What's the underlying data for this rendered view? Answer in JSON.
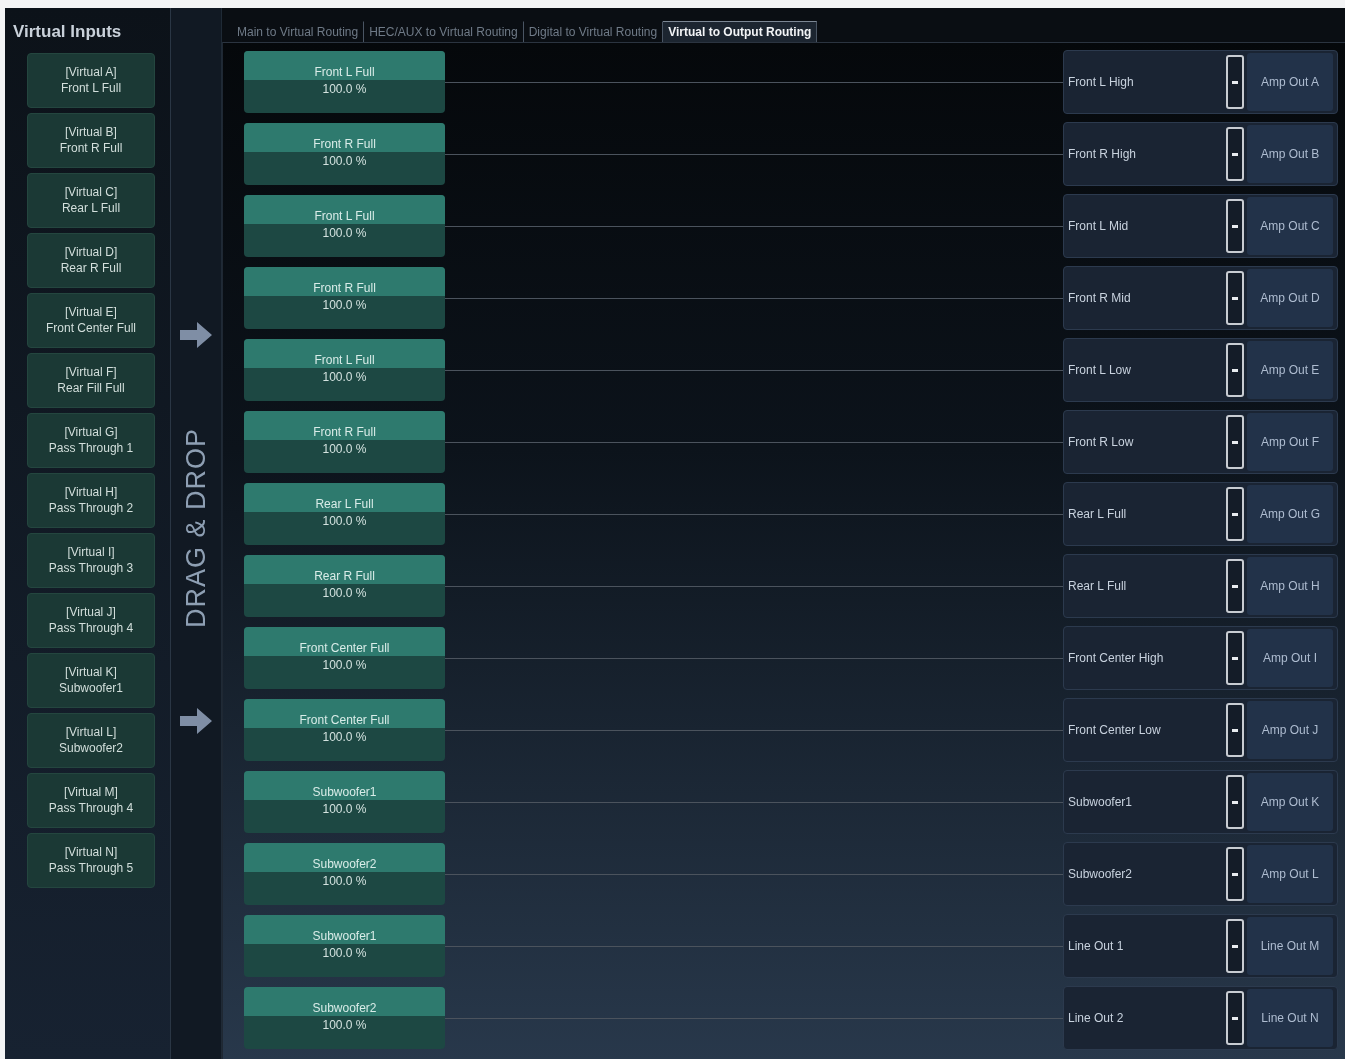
{
  "sidebar": {
    "title": "Virtual Inputs",
    "items": [
      {
        "name": "[Virtual A]",
        "source": "Front L Full"
      },
      {
        "name": "[Virtual B]",
        "source": "Front R Full"
      },
      {
        "name": "[Virtual C]",
        "source": "Rear L Full"
      },
      {
        "name": "[Virtual D]",
        "source": "Rear R Full"
      },
      {
        "name": "[Virtual E]",
        "source": "Front Center Full"
      },
      {
        "name": "[Virtual F]",
        "source": "Rear Fill Full"
      },
      {
        "name": "[Virtual G]",
        "source": "Pass Through 1"
      },
      {
        "name": "[Virtual H]",
        "source": "Pass Through 2"
      },
      {
        "name": "[Virtual I]",
        "source": "Pass Through 3"
      },
      {
        "name": "[Virtual J]",
        "source": "Pass Through 4"
      },
      {
        "name": "[Virtual K]",
        "source": "Subwoofer1"
      },
      {
        "name": "[Virtual L]",
        "source": "Subwoofer2"
      },
      {
        "name": "[Virtual M]",
        "source": "Pass Through 4"
      },
      {
        "name": "[Virtual N]",
        "source": "Pass Through 5"
      }
    ]
  },
  "drag_hint": {
    "label": "DRAG & DROP"
  },
  "tabs": [
    {
      "label": "Main to Virtual Routing",
      "selected": false
    },
    {
      "label": "HEC/AUX to Virtual Routing",
      "selected": false
    },
    {
      "label": "Digital to Virtual Routing",
      "selected": false
    },
    {
      "label": "Virtual to Output Routing",
      "selected": true
    }
  ],
  "routes": [
    {
      "input": "Front L Full",
      "gain": "100.0 %",
      "channel": "Front L High",
      "output": "Amp Out A"
    },
    {
      "input": "Front R Full",
      "gain": "100.0 %",
      "channel": "Front R High",
      "output": "Amp Out B"
    },
    {
      "input": "Front L Full",
      "gain": "100.0 %",
      "channel": "Front L Mid",
      "output": "Amp Out C"
    },
    {
      "input": "Front R Full",
      "gain": "100.0 %",
      "channel": "Front R Mid",
      "output": "Amp Out D"
    },
    {
      "input": "Front L Full",
      "gain": "100.0 %",
      "channel": "Front L Low",
      "output": "Amp Out E"
    },
    {
      "input": "Front R Full",
      "gain": "100.0 %",
      "channel": "Front R Low",
      "output": "Amp Out F"
    },
    {
      "input": "Rear L Full",
      "gain": "100.0 %",
      "channel": "Rear L Full",
      "output": "Amp Out G"
    },
    {
      "input": "Rear R Full",
      "gain": "100.0 %",
      "channel": "Rear L Full",
      "output": "Amp Out H"
    },
    {
      "input": "Front Center Full",
      "gain": "100.0 %",
      "channel": "Front Center High",
      "output": "Amp Out I"
    },
    {
      "input": "Front Center Full",
      "gain": "100.0 %",
      "channel": "Front Center Low",
      "output": "Amp Out J"
    },
    {
      "input": "Subwoofer1",
      "gain": "100.0 %",
      "channel": "Subwoofer1",
      "output": "Amp Out K"
    },
    {
      "input": "Subwoofer2",
      "gain": "100.0 %",
      "channel": "Subwoofer2",
      "output": "Amp Out L"
    },
    {
      "input": "Subwoofer1",
      "gain": "100.0 %",
      "channel": "Line Out 1",
      "output": "Line Out M"
    },
    {
      "input": "Subwoofer2",
      "gain": "100.0 %",
      "channel": "Line Out 2",
      "output": "Line Out N"
    }
  ]
}
